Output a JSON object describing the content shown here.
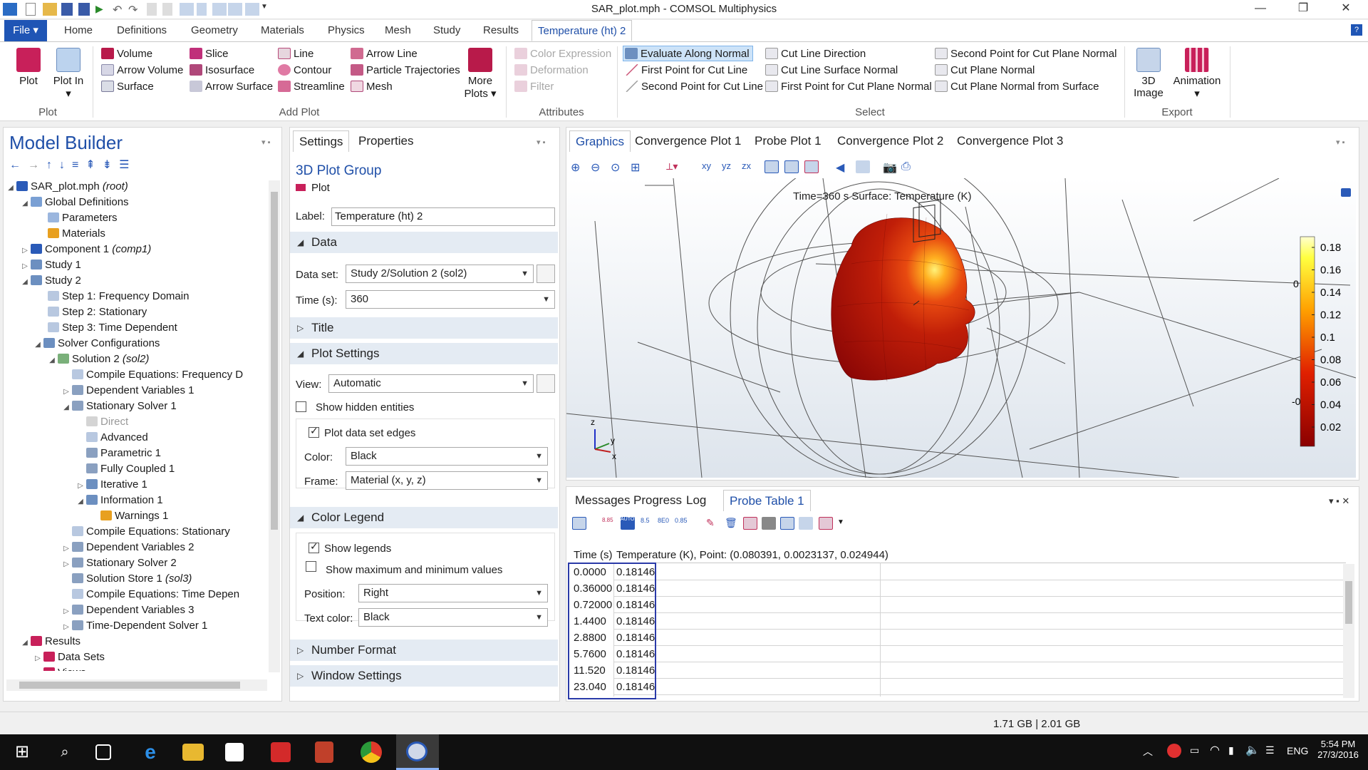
{
  "window": {
    "title": "SAR_plot.mph - COMSOL Multiphysics"
  },
  "ribbon_tabs": [
    "File",
    "Home",
    "Definitions",
    "Geometry",
    "Materials",
    "Physics",
    "Mesh",
    "Study",
    "Results",
    "Temperature (ht) 2"
  ],
  "ribbon": {
    "plot_group": {
      "plot": "Plot",
      "plot_in": "Plot In",
      "label": "Plot"
    },
    "add_plot": {
      "items": [
        "Volume",
        "Slice",
        "Line",
        "Arrow Line",
        "Arrow Volume",
        "Isosurface",
        "Contour",
        "Particle Trajectories",
        "Surface",
        "Arrow Surface",
        "Streamline",
        "Mesh"
      ],
      "more_plots": "More Plots",
      "label": "Add Plot"
    },
    "attributes": {
      "items": [
        "Color Expression",
        "Deformation",
        "Filter"
      ],
      "label": "Attributes"
    },
    "select": {
      "items": [
        "Evaluate Along Normal",
        "First Point for Cut Line",
        "Second Point for Cut Line",
        "Cut Line Direction",
        "Cut Line Surface Normal",
        "First Point for Cut Plane Normal",
        "Second Point for Cut Plane Normal",
        "Cut Plane Normal",
        "Cut Plane Normal from Surface"
      ],
      "label": "Select"
    },
    "export": {
      "image": "3D Image",
      "animation": "Animation",
      "label": "Export"
    }
  },
  "model_builder": {
    "title": "Model Builder",
    "tree": [
      {
        "text": "SAR_plot.mph",
        "suffix": " (root)"
      },
      {
        "text": "Global Definitions",
        "suffix": ""
      },
      {
        "text": "Parameters",
        "suffix": ""
      },
      {
        "text": "Materials",
        "suffix": ""
      },
      {
        "text": "Component 1",
        "suffix": " (comp1)"
      },
      {
        "text": "Study 1",
        "suffix": ""
      },
      {
        "text": "Study 2",
        "suffix": ""
      },
      {
        "text": "Step 1: Frequency Domain",
        "suffix": ""
      },
      {
        "text": "Step 2: Stationary",
        "suffix": ""
      },
      {
        "text": "Step 3: Time Dependent",
        "suffix": ""
      },
      {
        "text": "Solver Configurations",
        "suffix": ""
      },
      {
        "text": "Solution 2",
        "suffix": " (sol2)"
      },
      {
        "text": "Compile Equations: Frequency D",
        "suffix": ""
      },
      {
        "text": "Dependent Variables 1",
        "suffix": ""
      },
      {
        "text": "Stationary Solver 1",
        "suffix": ""
      },
      {
        "text": "Direct",
        "suffix": ""
      },
      {
        "text": "Advanced",
        "suffix": ""
      },
      {
        "text": "Parametric 1",
        "suffix": ""
      },
      {
        "text": "Fully Coupled 1",
        "suffix": ""
      },
      {
        "text": "Iterative 1",
        "suffix": ""
      },
      {
        "text": "Information 1",
        "suffix": ""
      },
      {
        "text": "Warnings 1",
        "suffix": ""
      },
      {
        "text": "Compile Equations: Stationary",
        "suffix": ""
      },
      {
        "text": "Dependent Variables 2",
        "suffix": ""
      },
      {
        "text": "Stationary Solver 2",
        "suffix": ""
      },
      {
        "text": "Solution Store 1",
        "suffix": " (sol3)"
      },
      {
        "text": "Compile Equations: Time Depen",
        "suffix": ""
      },
      {
        "text": "Dependent Variables 3",
        "suffix": ""
      },
      {
        "text": "Time-Dependent Solver 1",
        "suffix": ""
      },
      {
        "text": "Results",
        "suffix": ""
      },
      {
        "text": "Data Sets",
        "suffix": ""
      },
      {
        "text": "Views",
        "suffix": ""
      }
    ]
  },
  "settings": {
    "tabs": [
      "Settings",
      "Properties"
    ],
    "heading": "3D Plot Group",
    "plot_button": "Plot",
    "label_caption": "Label:",
    "label_value": "Temperature (ht) 2",
    "sections": {
      "data": "Data",
      "title": "Title",
      "plot_settings": "Plot Settings",
      "color_legend": "Color Legend",
      "number_format": "Number Format",
      "window_settings": "Window Settings"
    },
    "data_set_caption": "Data set:",
    "data_set_value": "Study 2/Solution 2 (sol2)",
    "time_caption": "Time (s):",
    "time_value": "360",
    "view_caption": "View:",
    "view_value": "Automatic",
    "show_hidden": "Show hidden entities",
    "plot_edges": "Plot data set edges",
    "color_caption": "Color:",
    "color_value": "Black",
    "frame_caption": "Frame:",
    "frame_value": "Material  (x, y, z)",
    "show_legends": "Show legends",
    "show_maxmin": "Show maximum and minimum values",
    "position_caption": "Position:",
    "position_value": "Right",
    "textcolor_caption": "Text color:",
    "textcolor_value": "Black"
  },
  "graphics": {
    "tabs": [
      "Graphics",
      "Convergence Plot 1",
      "Probe Plot 1",
      "Convergence Plot 2",
      "Convergence Plot 3"
    ],
    "plot_title": "Time=360 s   Surface: Temperature (K)",
    "legend_ticks": [
      "0.18",
      "0.16",
      "0.14",
      "0.12",
      "0.1",
      "0.08",
      "0.06",
      "0.04",
      "0.02"
    ],
    "axis_z": "z",
    "axis_y": "y",
    "axis_x": "x",
    "side_label_top": "0",
    "side_label_bottom": "-0"
  },
  "bottom_panel": {
    "tabs": [
      "Messages",
      "Progress",
      "Log",
      "Probe Table 1"
    ],
    "col_time": "Time (s)",
    "col_temp": "Temperature (K), Point: (0.080391, 0.0023137, 0.024944)",
    "rows": [
      [
        "0.0000",
        "0.18146"
      ],
      [
        "0.36000",
        "0.18146"
      ],
      [
        "0.72000",
        "0.18146"
      ],
      [
        "1.4400",
        "0.18146"
      ],
      [
        "2.8800",
        "0.18146"
      ],
      [
        "5.7600",
        "0.18146"
      ],
      [
        "11.520",
        "0.18146"
      ],
      [
        "23.040",
        "0.18146"
      ]
    ]
  },
  "status": {
    "memory": "1.71 GB | 2.01 GB"
  },
  "taskbar": {
    "lang": "ENG",
    "time": "5:54 PM",
    "date": "27/3/2016"
  },
  "colors": {
    "accent": "#1f4fa8",
    "file_tab": "#1f55b5",
    "section_bg": "#e4ebf3",
    "probe_highlight": "#2a3aa8"
  }
}
